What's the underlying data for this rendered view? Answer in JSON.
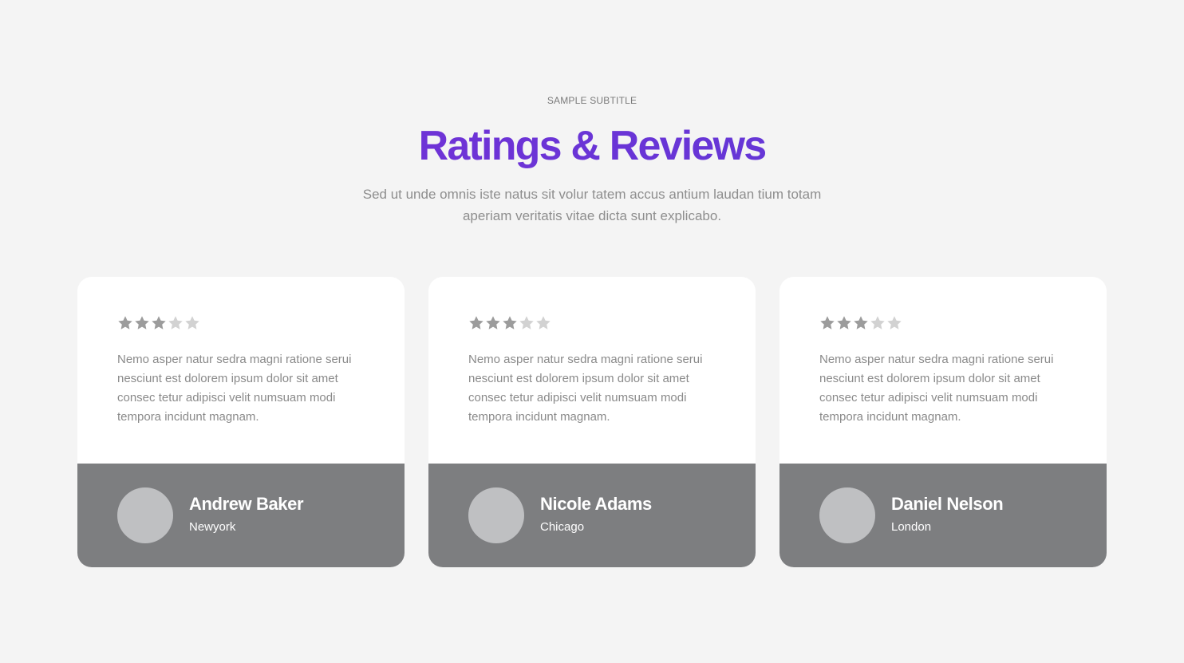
{
  "header": {
    "subtitle": "SAMPLE SUBTITLE",
    "title": "Ratings & Reviews",
    "intro": "Sed ut unde omnis iste natus sit volur tatem accus antium laudan tium totam aperiam veritatis vitae dicta sunt explicabo."
  },
  "colors": {
    "title_gradient_start": "#7a2fd8",
    "title_gradient_end": "#5b3bd8",
    "page_background": "#f4f4f4",
    "card_footer": "#7d7e80",
    "avatar_placeholder": "#bfc0c2",
    "star_filled": "#9c9c9c",
    "star_empty": "#d2d2d2"
  },
  "rating_scale": 5,
  "reviews": [
    {
      "rating": 3,
      "text": "Nemo asper natur sedra magni ratione serui nesciunt est dolorem ipsum dolor sit amet consec tetur adipisci velit numsuam modi tempora incidunt magnam.",
      "name": "Andrew Baker",
      "city": "Newyork",
      "avatar_icon": "avatar-placeholder"
    },
    {
      "rating": 3,
      "text": "Nemo asper natur sedra magni ratione serui nesciunt est dolorem ipsum dolor sit amet consec tetur adipisci velit numsuam modi tempora incidunt magnam.",
      "name": "Nicole Adams",
      "city": "Chicago",
      "avatar_icon": "avatar-placeholder"
    },
    {
      "rating": 3,
      "text": "Nemo asper natur sedra magni ratione serui nesciunt est dolorem ipsum dolor sit amet consec tetur adipisci velit numsuam modi tempora incidunt magnam.",
      "name": "Daniel Nelson",
      "city": "London",
      "avatar_icon": "avatar-placeholder"
    }
  ]
}
